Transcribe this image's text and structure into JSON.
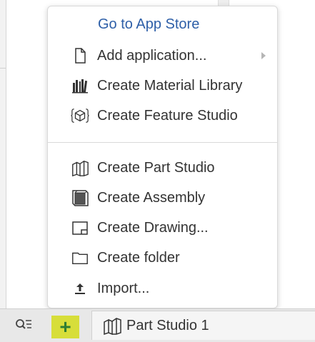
{
  "menu": {
    "store_link": "Go to App Store",
    "items": [
      {
        "label": "Add application...",
        "icon": "document-icon",
        "has_submenu": true
      },
      {
        "label": "Create Material Library",
        "icon": "material-library-icon"
      },
      {
        "label": "Create Feature Studio",
        "icon": "feature-studio-icon"
      },
      {
        "label": "Create Part Studio",
        "icon": "part-studio-icon"
      },
      {
        "label": "Create Assembly",
        "icon": "assembly-icon"
      },
      {
        "label": "Create Drawing...",
        "icon": "drawing-icon"
      },
      {
        "label": "Create folder",
        "icon": "folder-icon"
      },
      {
        "label": "Import...",
        "icon": "import-icon"
      }
    ]
  },
  "bottom_bar": {
    "filter_icon": "filter-list-icon",
    "add_button": "+",
    "tab_label": "Part Studio 1",
    "tab_icon": "part-studio-icon"
  },
  "colors": {
    "link": "#2e5fa8",
    "add_button_bg": "#d7de3a",
    "add_button_fg": "#2e7d32"
  }
}
